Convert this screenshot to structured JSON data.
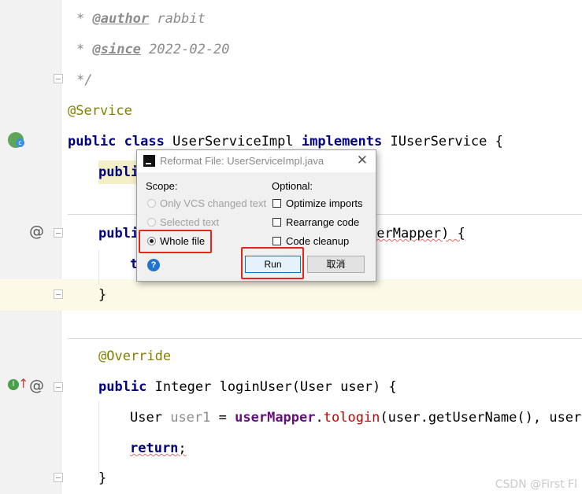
{
  "code": {
    "author_tag": "@author",
    "author_value": "rabbit",
    "since_tag": "@since",
    "since_value": "2022-02-20",
    "comment_end": "*/",
    "comment_star": "*",
    "annotation_service": "@Service",
    "kw_public": "public",
    "kw_class": "class",
    "class_name": "UserServiceImpl",
    "kw_implements": "implements",
    "interface_name": "IUserService",
    "open_brace": "{",
    "close_brace": "}",
    "line_publi_partial": "publi",
    "line_publi_partial2": "publi",
    "line_ser_mapper": "serMapper) {",
    "line_t_partial": "t",
    "annotation_override": "@Override",
    "return_type": "Integer",
    "method_sig": "loginUser(User user) {",
    "local_type": "User",
    "local_var": "user1",
    "assign": "=",
    "field_ref": "userMapper",
    "dot": ".",
    "method_call": "tologin",
    "call_args": "(user.getUserName(), user.g",
    "kw_return": "return",
    "semicolon": ";"
  },
  "gutter": {
    "class_icon": "spring-bean-class-icon",
    "at_icon": "@",
    "at_icon2": "@",
    "impl_icon": "I",
    "impl_arrow": "↑"
  },
  "dialog": {
    "title": "Reformat File: UserServiceImpl.java",
    "close": "✕",
    "scope_label": "Scope:",
    "optional_label": "Optional:",
    "scope_options": [
      "Only VCS changed text",
      "Selected text",
      "Whole file"
    ],
    "optional_options": [
      "Optimize imports",
      "Rearrange code",
      "Code cleanup"
    ],
    "run_button": "Run",
    "cancel_button": "取消",
    "help": "?"
  },
  "watermark": "CSDN @First Fl"
}
